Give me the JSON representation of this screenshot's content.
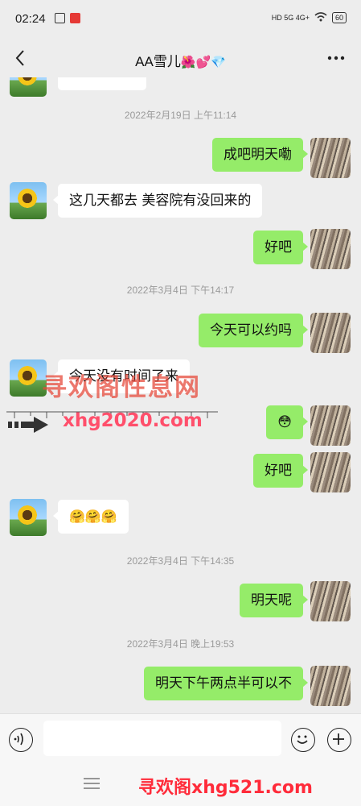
{
  "status_bar": {
    "time": "02:24",
    "network": "HD 5G 4G+",
    "battery": "60"
  },
  "header": {
    "title": "AA雪儿",
    "title_emoji": "🌺💕💎"
  },
  "messages": {
    "ts1": "2022年2月19日 上午11:14",
    "m1": "成吧明天嘞",
    "m2": "这几天都去 美容院有没回来的",
    "m3": "好吧",
    "ts2": "2022年3月4日 下午14:17",
    "m4": "今天可以约吗",
    "m5": "今天没有时间了来",
    "m6": "😳",
    "m7": "好吧",
    "m8": "🤗🤗🤗",
    "ts3": "2022年3月4日 下午14:35",
    "m9": "明天呢",
    "ts4": "2022年3月4日 晚上19:53",
    "m10": "明天下午两点半可以不"
  },
  "watermarks": {
    "mid_text": "寻欢阁性息网",
    "mid_url": "xhg2020.com",
    "bottom": "寻欢阁xhg521.com"
  },
  "colors": {
    "my_bubble": "#95ec69",
    "their_bubble": "#ffffff",
    "background": "#ededed"
  }
}
